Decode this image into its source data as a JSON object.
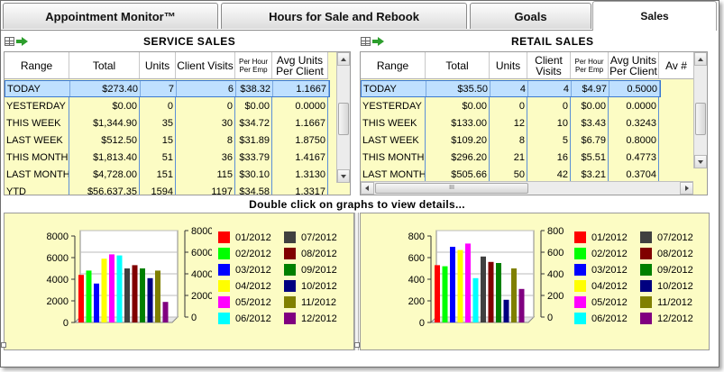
{
  "tabs": [
    {
      "label": "Appointment Monitor™"
    },
    {
      "label": "Hours for Sale and Rebook"
    },
    {
      "label": "Goals"
    },
    {
      "label": "Sales"
    }
  ],
  "service": {
    "title": "SERVICE SALES",
    "headers": [
      "Range",
      "Total",
      "Units",
      "Client Visits",
      "Per Hour Per Emp",
      "Avg Units Per Client"
    ],
    "rows": [
      [
        "TODAY",
        "$273.40",
        "7",
        "6",
        "$38.32",
        "1.1667"
      ],
      [
        "YESTERDAY",
        "$0.00",
        "0",
        "0",
        "$0.00",
        "0.0000"
      ],
      [
        "THIS WEEK",
        "$1,344.90",
        "35",
        "30",
        "$34.72",
        "1.1667"
      ],
      [
        "LAST WEEK",
        "$512.50",
        "15",
        "8",
        "$31.89",
        "1.8750"
      ],
      [
        "THIS MONTH",
        "$1,813.40",
        "51",
        "36",
        "$33.79",
        "1.4167"
      ],
      [
        "LAST MONTH",
        "$4,728.00",
        "151",
        "115",
        "$30.10",
        "1.3130"
      ],
      [
        "YTD",
        "$56,637.35",
        "1594",
        "1197",
        "$34.58",
        "1.3317"
      ]
    ]
  },
  "retail": {
    "title": "RETAIL SALES",
    "headers": [
      "Range",
      "Total",
      "Units",
      "Client Visits",
      "Per Hour Per Emp",
      "Avg Units Per Client",
      "Av #"
    ],
    "rows": [
      [
        "TODAY",
        "$35.50",
        "4",
        "4",
        "$4.97",
        "0.5000"
      ],
      [
        "YESTERDAY",
        "$0.00",
        "0",
        "0",
        "$0.00",
        "0.0000"
      ],
      [
        "THIS WEEK",
        "$133.00",
        "12",
        "10",
        "$3.43",
        "0.3243"
      ],
      [
        "LAST WEEK",
        "$109.20",
        "8",
        "5",
        "$6.79",
        "0.8000"
      ],
      [
        "THIS MONTH",
        "$296.20",
        "21",
        "16",
        "$5.51",
        "0.4773"
      ],
      [
        "LAST MONTH",
        "$505.66",
        "50",
        "42",
        "$3.21",
        "0.3704"
      ]
    ],
    "hscroll_grip": "III"
  },
  "hint": "Double click on graphs to view details...",
  "colors": {
    "tab_active_bg": "#ffffff",
    "grid_bg": "#fcfcc4",
    "selection": "#bfe0ff",
    "series": [
      "#ff0000",
      "#00ff00",
      "#0000ff",
      "#ffff00",
      "#ff00ff",
      "#00ffff",
      "#404040",
      "#800000",
      "#008000",
      "#000080",
      "#808000",
      "#800080"
    ]
  },
  "chart_data": [
    {
      "type": "bar",
      "categories": [
        "01/2012",
        "02/2012",
        "03/2012",
        "04/2012",
        "05/2012",
        "06/2012",
        "07/2012",
        "08/2012",
        "09/2012",
        "10/2012",
        "11/2012",
        "12/2012"
      ],
      "values": [
        4400,
        4800,
        3600,
        5900,
        6300,
        6200,
        5000,
        5300,
        5000,
        4100,
        4800,
        1900
      ],
      "ylim": [
        0,
        8000
      ],
      "yticks": [
        "8000",
        "6000",
        "4000",
        "2000",
        "0"
      ],
      "legend": "right"
    },
    {
      "type": "bar",
      "categories": [
        "01/2012",
        "02/2012",
        "03/2012",
        "04/2012",
        "05/2012",
        "06/2012",
        "07/2012",
        "08/2012",
        "09/2012",
        "10/2012",
        "11/2012",
        "12/2012"
      ],
      "values": [
        530,
        520,
        700,
        670,
        730,
        410,
        610,
        560,
        550,
        210,
        500,
        310
      ],
      "ylim": [
        0,
        800
      ],
      "yticks": [
        "800",
        "600",
        "400",
        "200",
        "0"
      ],
      "legend": "right"
    }
  ]
}
